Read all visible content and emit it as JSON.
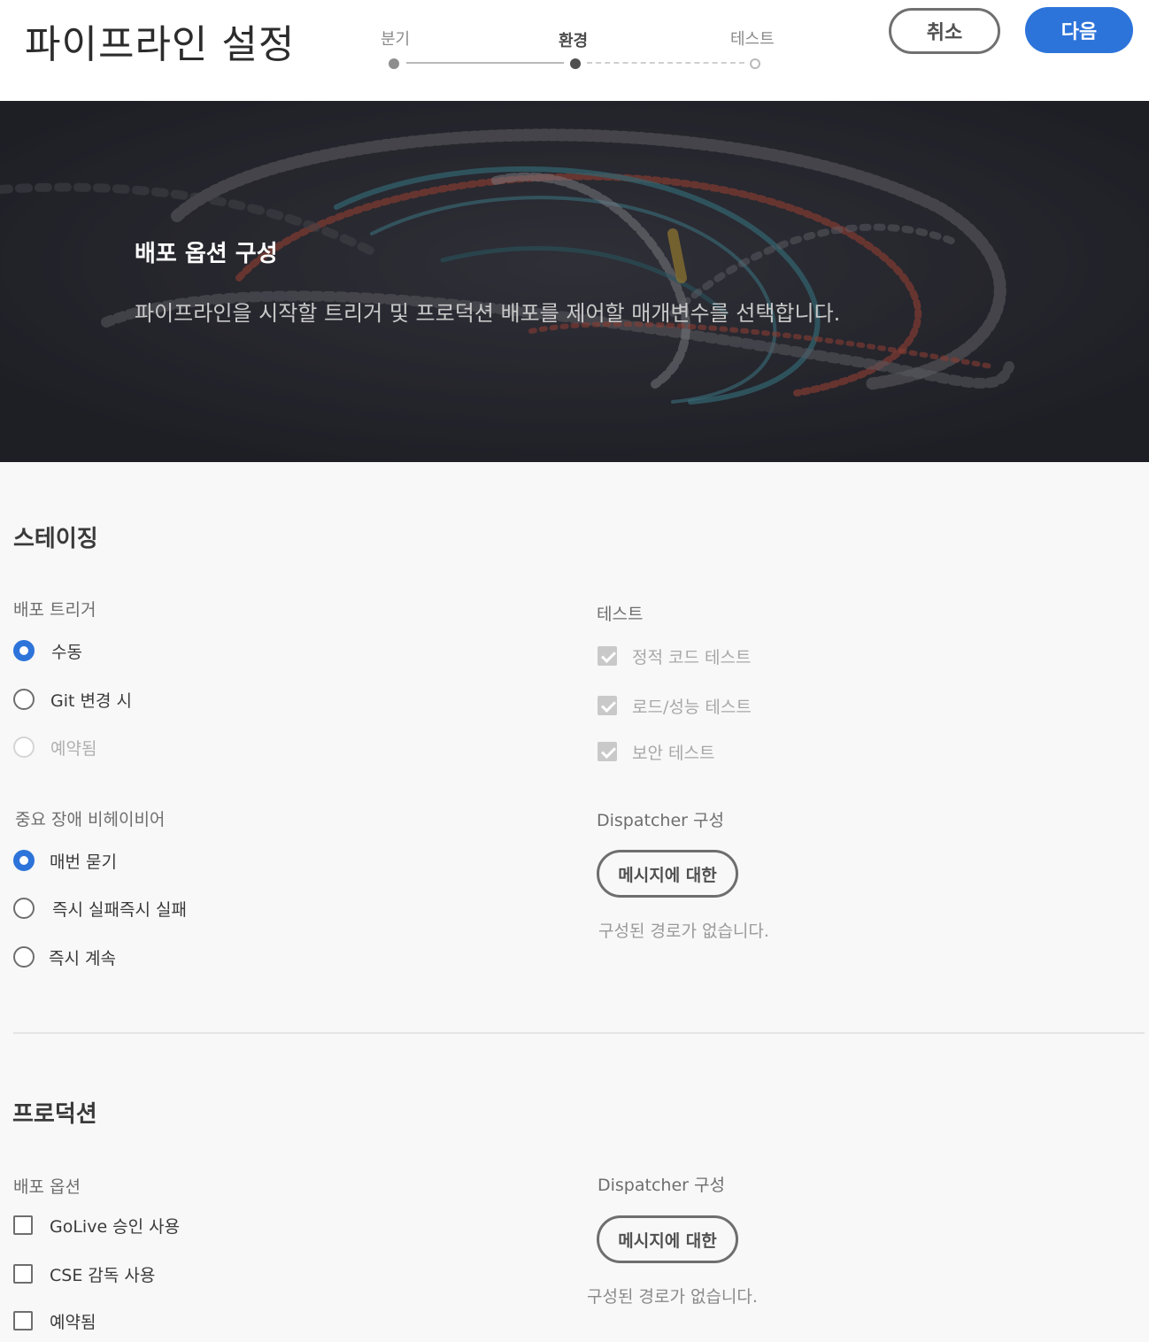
{
  "header": {
    "title": "파이프라인 설정",
    "steps": [
      {
        "label": "분기",
        "state": "done"
      },
      {
        "label": "환경",
        "state": "active"
      },
      {
        "label": "테스트",
        "state": "todo"
      }
    ],
    "cancel_label": "취소",
    "next_label": "다음"
  },
  "hero": {
    "title": "배포 옵션 구성",
    "description": "파이프라인을 시작할 트리거 및 프로덕션 배포를 제어할 매개변수를 선택합니다."
  },
  "staging": {
    "title": "스테이징",
    "deploy_trigger": {
      "label": "배포 트리거",
      "options": [
        {
          "label": "수동",
          "checked": true,
          "disabled": false
        },
        {
          "label": "Git 변경 시",
          "checked": false,
          "disabled": false
        },
        {
          "label": "예약됨",
          "checked": false,
          "disabled": true
        }
      ]
    },
    "important_failure": {
      "label": "중요 장애 비헤이비어",
      "options": [
        {
          "label": "매번 묻기",
          "checked": true
        },
        {
          "label": "즉시 실패즉시 실패",
          "checked": false
        },
        {
          "label": "즉시 계속",
          "checked": false
        }
      ]
    },
    "tests": {
      "label": "테스트",
      "items": [
        {
          "label": "정적 코드 테스트",
          "checked": true,
          "disabled": true
        },
        {
          "label": "로드/성능 테스트",
          "checked": true,
          "disabled": true
        },
        {
          "label": "보안 테스트",
          "checked": true,
          "disabled": true
        }
      ]
    },
    "dispatcher": {
      "label": "Dispatcher 구성",
      "button_label": "메시지에 대한",
      "empty_text": "구성된 경로가 없습니다."
    }
  },
  "production": {
    "title": "프로덕션",
    "deploy_options": {
      "label": "배포 옵션",
      "items": [
        {
          "label": "GoLive 승인 사용",
          "checked": false
        },
        {
          "label": "CSE 감독 사용",
          "checked": false
        },
        {
          "label": "예약됨",
          "checked": false
        }
      ]
    },
    "dispatcher": {
      "label": "Dispatcher 구성",
      "button_label": "메시지에 대한",
      "empty_text": "구성된 경로가 없습니다."
    }
  },
  "colors": {
    "accent": "#2d74da",
    "hero_background": "#26262c"
  }
}
